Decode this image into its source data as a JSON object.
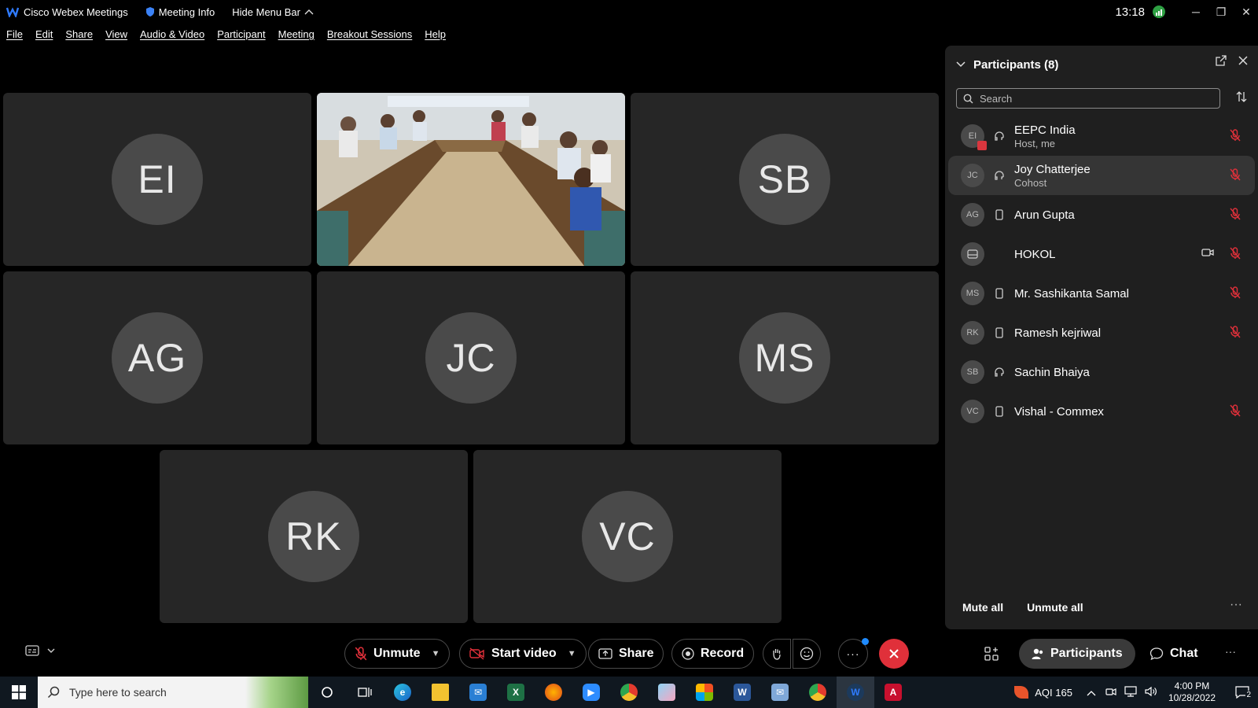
{
  "titlebar": {
    "app_title": "Cisco Webex Meetings",
    "meeting_info": "Meeting Info",
    "hide_menu_bar": "Hide Menu Bar",
    "time": "13:18"
  },
  "menu": [
    "File",
    "Edit",
    "Share",
    "View",
    "Audio & Video",
    "Participant",
    "Meeting",
    "Breakout Sessions",
    "Help"
  ],
  "grid": {
    "tiles": [
      {
        "initials": "EI"
      },
      {
        "initials": "",
        "video": true
      },
      {
        "initials": "SB"
      },
      {
        "initials": "AG"
      },
      {
        "initials": "JC"
      },
      {
        "initials": "MS"
      },
      {
        "initials": "RK"
      },
      {
        "initials": "VC"
      }
    ]
  },
  "participants": {
    "title": "Participants (8)",
    "search_placeholder": "Search",
    "list": [
      {
        "initials": "EI",
        "name": "EEPC India",
        "role": "Host, me",
        "device": "headset-icon",
        "muted": true,
        "camera": false
      },
      {
        "initials": "JC",
        "name": "Joy Chatterjee",
        "role": "Cohost",
        "device": "headset-icon",
        "muted": true,
        "camera": false
      },
      {
        "initials": "AG",
        "name": "Arun Gupta",
        "role": "",
        "device": "phone-icon",
        "muted": true,
        "camera": false
      },
      {
        "initials": "",
        "name": "HOKOL",
        "role": "",
        "device": "",
        "muted": true,
        "camera": true
      },
      {
        "initials": "MS",
        "name": "Mr. Sashikanta Samal",
        "role": "",
        "device": "phone-icon",
        "muted": true,
        "camera": false
      },
      {
        "initials": "RK",
        "name": "Ramesh kejriwal",
        "role": "",
        "device": "phone-icon",
        "muted": true,
        "camera": false
      },
      {
        "initials": "SB",
        "name": "Sachin Bhaiya",
        "role": "",
        "device": "headset-icon",
        "muted": false,
        "camera": false
      },
      {
        "initials": "VC",
        "name": "Vishal - Commex",
        "role": "",
        "device": "phone-icon",
        "muted": true,
        "camera": false
      }
    ],
    "mute_all": "Mute all",
    "unmute_all": "Unmute all"
  },
  "controls": {
    "unmute": "Unmute",
    "start_video": "Start video",
    "share": "Share",
    "record": "Record",
    "participants": "Participants",
    "chat": "Chat"
  },
  "taskbar": {
    "search_placeholder": "Type here to search",
    "aqi": "AQI 165",
    "time": "4:00 PM",
    "date": "10/28/2022",
    "notifications": "2"
  },
  "colors": {
    "end_call": "#e0303a",
    "accent_blue": "#1f8bff",
    "muted_red": "#e0303a"
  }
}
